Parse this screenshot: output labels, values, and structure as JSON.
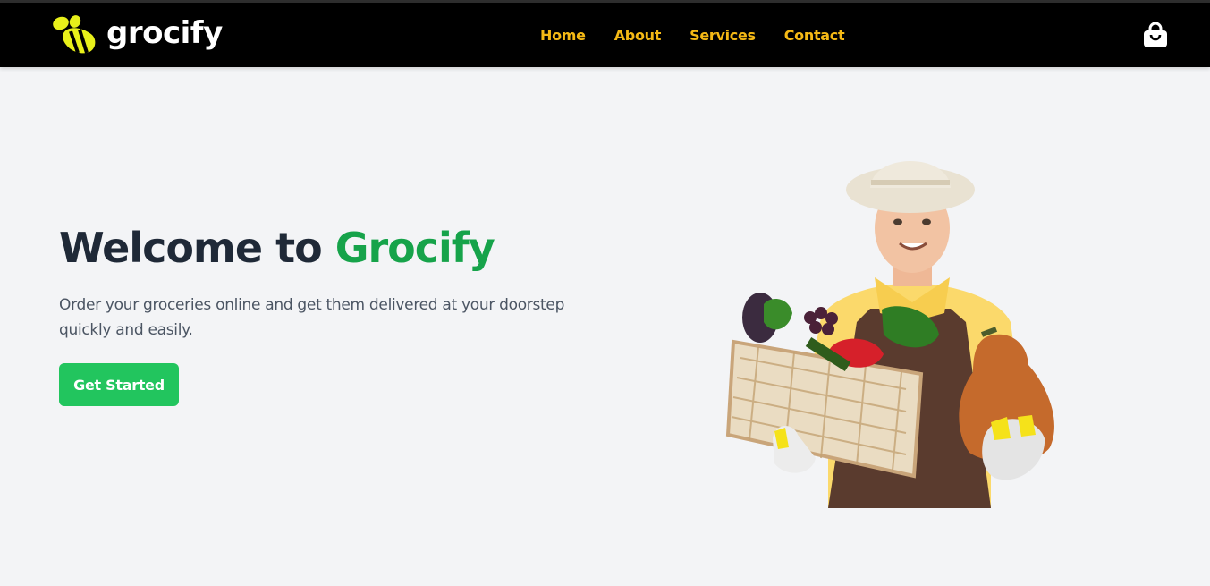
{
  "navbar": {
    "brand": "grocify",
    "links": [
      {
        "label": "Home"
      },
      {
        "label": "About"
      },
      {
        "label": "Services"
      },
      {
        "label": "Contact"
      }
    ],
    "cart_icon": "shopping-bag-icon"
  },
  "hero": {
    "title_prefix": "Welcome to ",
    "title_accent": "Grocify",
    "subtitle": "Order your groceries online and get them delivered at your doorstep quickly and easily.",
    "cta_label": "Get Started"
  },
  "colors": {
    "navbar_bg": "#000000",
    "nav_link": "#f5b915",
    "accent_green": "#16a34a",
    "button_green": "#22c55e",
    "page_bg": "#f3f4f6",
    "logo_yellow": "#e8f01a"
  }
}
